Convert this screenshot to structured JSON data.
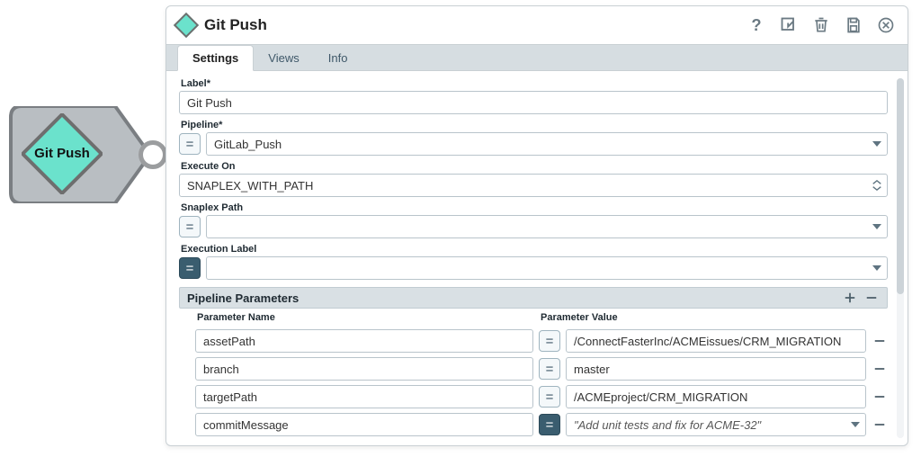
{
  "snap": {
    "label": "Git Push"
  },
  "panel": {
    "title": "Git Push"
  },
  "tabs": {
    "settings": "Settings",
    "views": "Views",
    "info": "Info"
  },
  "fields": {
    "label": {
      "label": "Label*",
      "value": "Git Push"
    },
    "pipeline": {
      "label": "Pipeline*",
      "value": "GitLab_Push"
    },
    "executeOn": {
      "label": "Execute On",
      "value": "SNAPLEX_WITH_PATH"
    },
    "snaplexPath": {
      "label": "Snaplex Path",
      "value": ""
    },
    "execLabel": {
      "label": "Execution Label",
      "value": ""
    }
  },
  "pipelineParams": {
    "section_title": "Pipeline Parameters",
    "col_name": "Parameter Name",
    "col_value": "Parameter Value",
    "rows": [
      {
        "name": "assetPath",
        "value": "/ConnectFasterInc/ACMEissues/CRM_MIGRATION",
        "expr_on": false,
        "has_caret": false
      },
      {
        "name": "branch",
        "value": "master",
        "expr_on": false,
        "has_caret": false
      },
      {
        "name": "targetPath",
        "value": "/ACMEproject/CRM_MIGRATION",
        "expr_on": false,
        "has_caret": false
      },
      {
        "name": "commitMessage",
        "value": "\"Add unit tests and fix for ACME-32\"",
        "expr_on": true,
        "has_caret": true
      }
    ]
  }
}
